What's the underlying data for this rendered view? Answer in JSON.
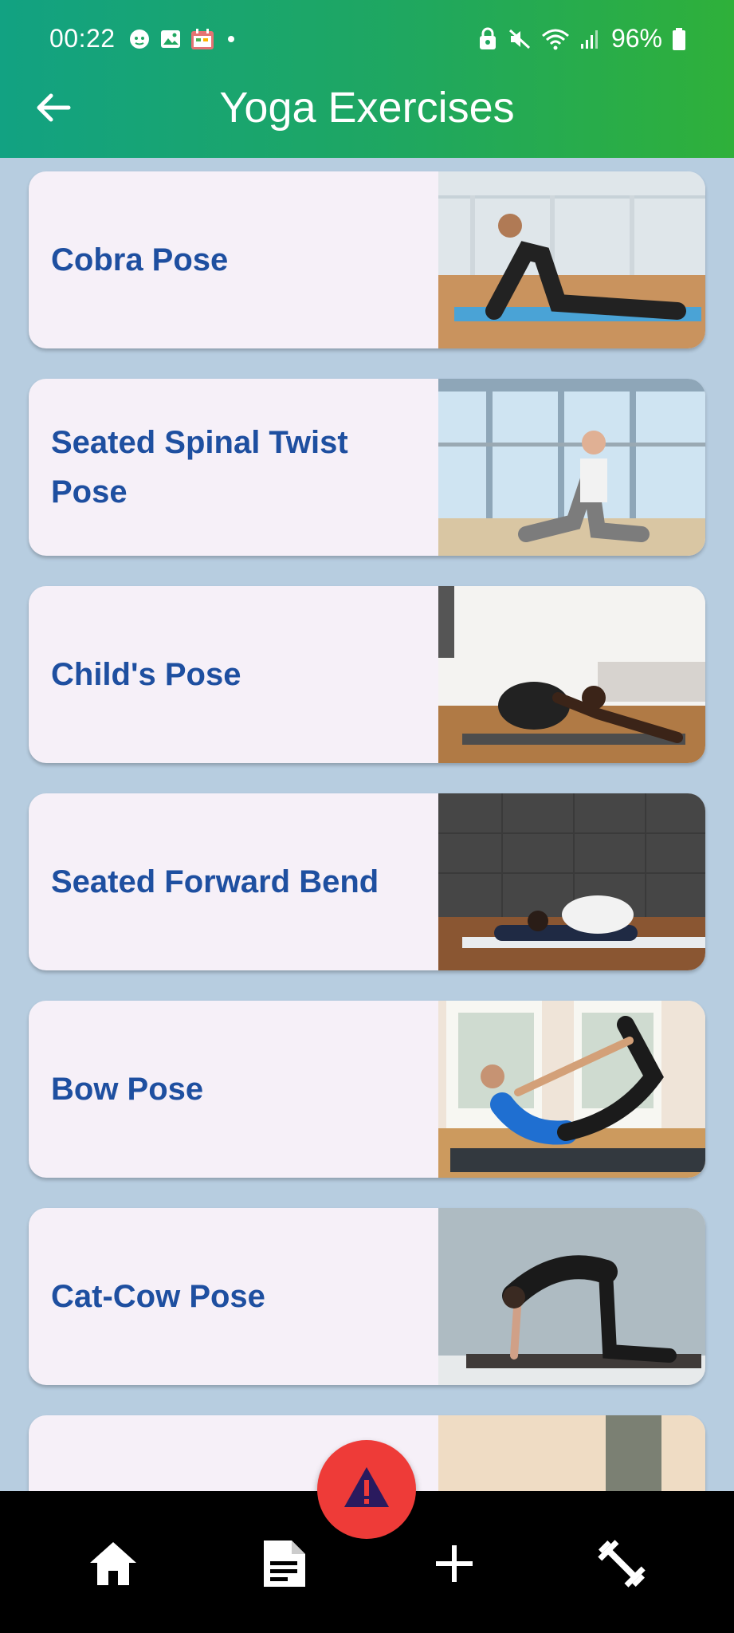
{
  "status_bar": {
    "time": "00:22",
    "battery": "96%",
    "left_icons": [
      "notification-face-icon",
      "image-icon",
      "calendar-app-icon",
      "dot-icon"
    ],
    "right_icons": [
      "lock-icon",
      "mute-icon",
      "wifi-icon",
      "signal-icon",
      "battery-icon"
    ]
  },
  "app_bar": {
    "title": "Yoga Exercises",
    "back_icon": "arrow-left-icon"
  },
  "exercises": [
    {
      "name": "Cobra Pose"
    },
    {
      "name": "Seated Spinal Twist Pose"
    },
    {
      "name": "Child's Pose"
    },
    {
      "name": "Seated Forward Bend"
    },
    {
      "name": "Bow Pose"
    },
    {
      "name": "Cat-Cow Pose"
    },
    {
      "name": ""
    }
  ],
  "fab": {
    "icon": "warning-icon",
    "color": "#ee3b38"
  },
  "bottom_nav": {
    "items": [
      {
        "icon": "home-icon"
      },
      {
        "icon": "document-icon"
      },
      {
        "icon": "plus-icon"
      },
      {
        "icon": "dumbbell-icon"
      }
    ]
  },
  "colors": {
    "header_start": "#12a282",
    "header_end": "#2fb03a",
    "background": "#b7cde0",
    "card": "#f6f0f8",
    "title_text": "#1e4fa0"
  }
}
